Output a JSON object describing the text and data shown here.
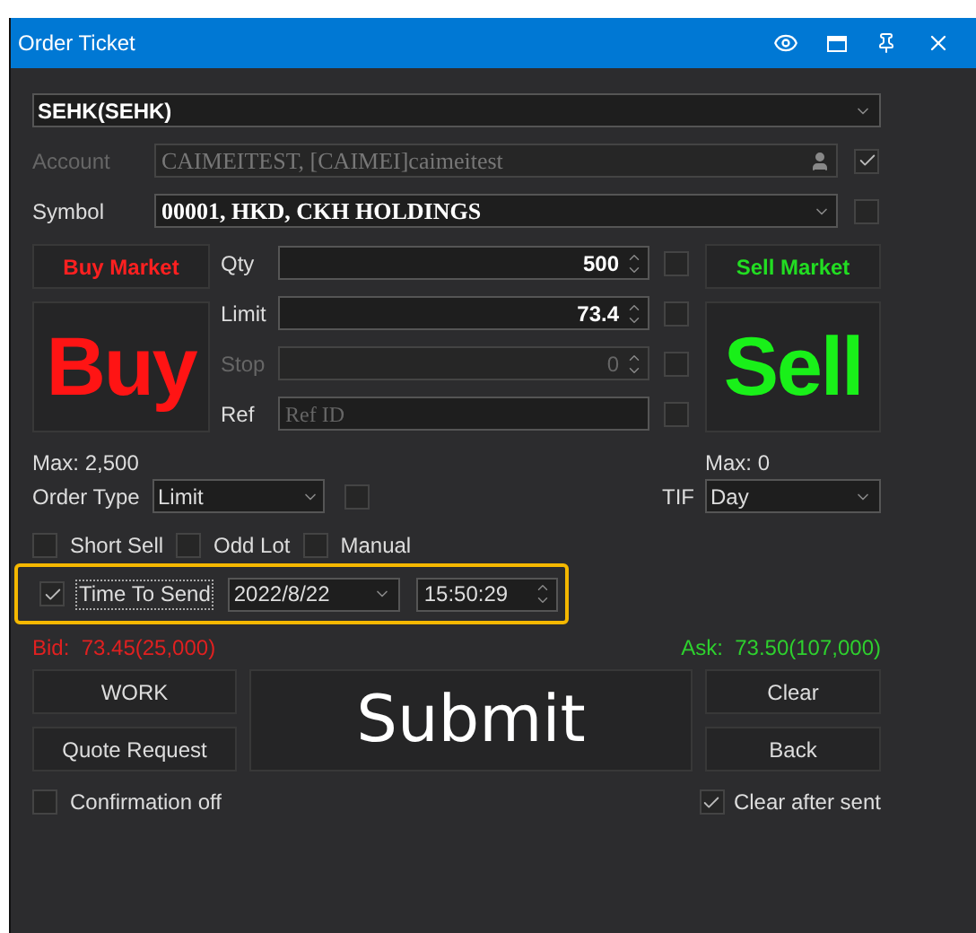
{
  "window": {
    "title": "Order Ticket"
  },
  "exchange": {
    "value": "SEHK(SEHK)"
  },
  "account": {
    "label": "Account",
    "value": "CAIMEITEST, [CAIMEI]caimeitest",
    "disabled": true,
    "checked": true
  },
  "symbol": {
    "label": "Symbol",
    "value": "00001, HKD, CKH HOLDINGS",
    "disabled": false,
    "checked": false
  },
  "buy_market": "Buy Market",
  "sell_market": "Sell Market",
  "buy": "Buy",
  "sell": "Sell",
  "fields": [
    {
      "kind": "spinner",
      "label": "Qty",
      "value": "500",
      "disabled": false,
      "checked": false
    },
    {
      "kind": "spinner",
      "label": "Limit",
      "value": "73.4",
      "disabled": false,
      "checked": false
    },
    {
      "kind": "spinner",
      "label": "Stop",
      "value": "0",
      "disabled": true,
      "checked": false
    },
    {
      "kind": "text",
      "label": "Ref",
      "placeholder": "Ref ID",
      "disabled": false,
      "checked": false
    }
  ],
  "max_buy": "Max: 2,500",
  "max_sell": "Max: 0",
  "order_type": {
    "label": "Order Type",
    "value": "Limit",
    "checked": false
  },
  "tif": {
    "label": "TIF",
    "value": "Day"
  },
  "options": [
    {
      "label": "Short Sell",
      "checked": false
    },
    {
      "label": "Odd Lot",
      "checked": false
    },
    {
      "label": "Manual",
      "checked": false
    }
  ],
  "time_to_send": {
    "label": "Time To Send",
    "checked": true,
    "date": "2022/8/22",
    "time": "15:50:29"
  },
  "bid": {
    "label": "Bid:",
    "value": "73.45(25,000)"
  },
  "ask": {
    "label": "Ask:",
    "value": "73.50(107,000)"
  },
  "buttons": {
    "work": "WORK",
    "quote_request": "Quote Request",
    "submit": "Submit",
    "clear": "Clear",
    "back": "Back"
  },
  "confirmation_off": {
    "label": "Confirmation off",
    "checked": false
  },
  "clear_after_sent": {
    "label": "Clear after sent",
    "checked": true
  }
}
